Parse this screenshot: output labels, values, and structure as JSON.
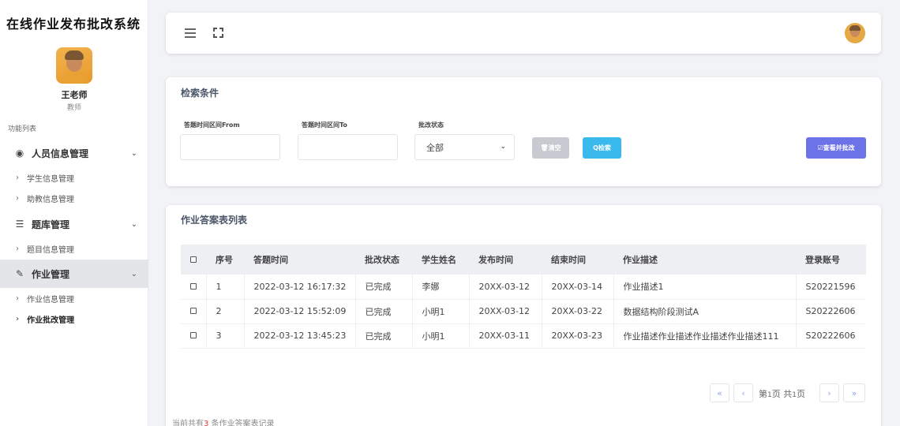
{
  "app_title": "在线作业发布批改系统",
  "user": {
    "name": "王老师",
    "role": "教师"
  },
  "menu_caption": "功能列表",
  "menu": {
    "group_people": "人员信息管理",
    "people_items": [
      "学生信息管理",
      "助教信息管理"
    ],
    "group_bank": "题库管理",
    "bank_items": [
      "题目信息管理"
    ],
    "group_homework": "作业管理",
    "homework_items": [
      "作业信息管理",
      "作业批改管理"
    ]
  },
  "search": {
    "title": "检索条件",
    "label_from": "答题时间区间From",
    "label_to": "答题时间区间To",
    "label_status": "批改状态",
    "status_selected": "全部",
    "btn_clear": "🗑清空",
    "btn_search": "Q检索",
    "btn_review": "☑查看并批改"
  },
  "table": {
    "title": "作业答案表列表",
    "headers": [
      "序号",
      "答题时间",
      "批改状态",
      "学生姓名",
      "发布时间",
      "结束时间",
      "作业描述",
      "登录账号"
    ],
    "rows": [
      [
        "1",
        "2022-03-12 16:17:32",
        "已完成",
        "李娜",
        "20XX-03-12",
        "20XX-03-14",
        "作业描述1",
        "S20221596"
      ],
      [
        "2",
        "2022-03-12 15:52:09",
        "已完成",
        "小明1",
        "20XX-03-12",
        "20XX-03-22",
        "数据结构阶段测试A",
        "S20222606"
      ],
      [
        "3",
        "2022-03-12 13:45:23",
        "已完成",
        "小明1",
        "20XX-03-11",
        "20XX-03-23",
        "作业描述作业描述作业描述作业描述111",
        "S20222606"
      ]
    ]
  },
  "pagination": {
    "first": "«",
    "prev": "‹",
    "page_prefix": "第",
    "page_num": "1",
    "page_mid": "页 共",
    "total_num": "1",
    "page_suffix": "页",
    "next": "›",
    "last": "»"
  },
  "records": {
    "prefix": "当前共有",
    "count": "3",
    "suffix": " 条作业答案表记录"
  }
}
